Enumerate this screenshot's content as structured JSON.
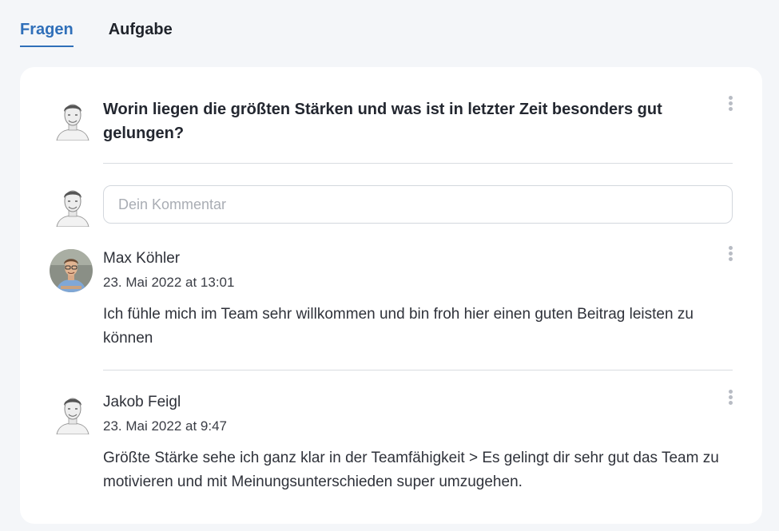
{
  "tabs": [
    {
      "label": "Fragen",
      "active": true
    },
    {
      "label": "Aufgabe",
      "active": false
    }
  ],
  "question": {
    "text": "Worin liegen die größten Stärken und was ist in letzter Zeit besonders gut gelungen?"
  },
  "comment_input": {
    "placeholder": "Dein Kommentar",
    "value": ""
  },
  "comments": [
    {
      "author": "Max Köhler",
      "date": "23. Mai 2022 at 13:01",
      "text": "Ich fühle mich im Team sehr willkommen und bin froh hier einen guten Beitrag leisten zu können"
    },
    {
      "author": "Jakob Feigl",
      "date": "23. Mai 2022 at 9:47",
      "text": "Größte Stärke sehe ich ganz klar in der Teamfähigkeit > Es gelingt dir sehr gut das Team zu motivieren und mit Meinungsunterschieden super umzugehen."
    }
  ],
  "colors": {
    "accent": "#2f6fb9",
    "page_background": "#f4f6f9",
    "card_background": "#ffffff",
    "divider": "#d9dce1"
  },
  "icons": {
    "menu": "kebab-menu-icon",
    "avatar_sketch": "avatar-sketch",
    "avatar_photo": "avatar-photo"
  }
}
